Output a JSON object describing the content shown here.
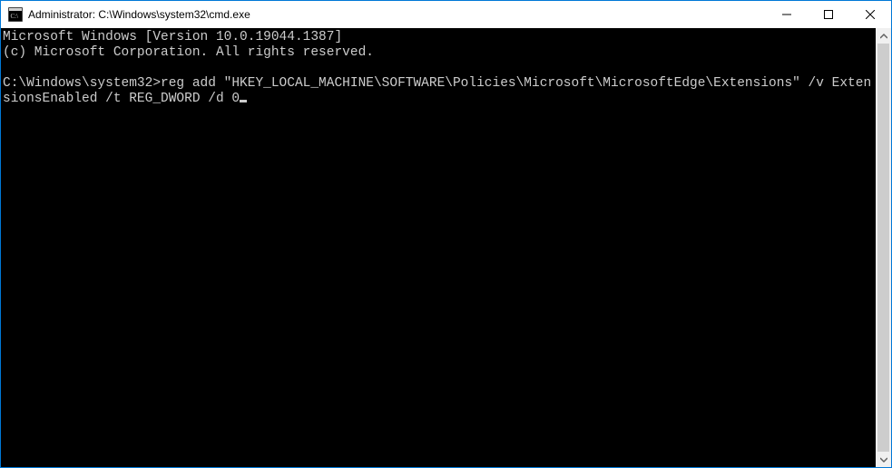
{
  "titlebar": {
    "title": "Administrator: C:\\Windows\\system32\\cmd.exe"
  },
  "terminal": {
    "header_line1": "Microsoft Windows [Version 10.0.19044.1387]",
    "header_line2": "(c) Microsoft Corporation. All rights reserved.",
    "prompt": "C:\\Windows\\system32>",
    "command": "reg add \"HKEY_LOCAL_MACHINE\\SOFTWARE\\Policies\\Microsoft\\MicrosoftEdge\\Extensions\" /v ExtensionsEnabled /t REG_DWORD /d 0"
  }
}
